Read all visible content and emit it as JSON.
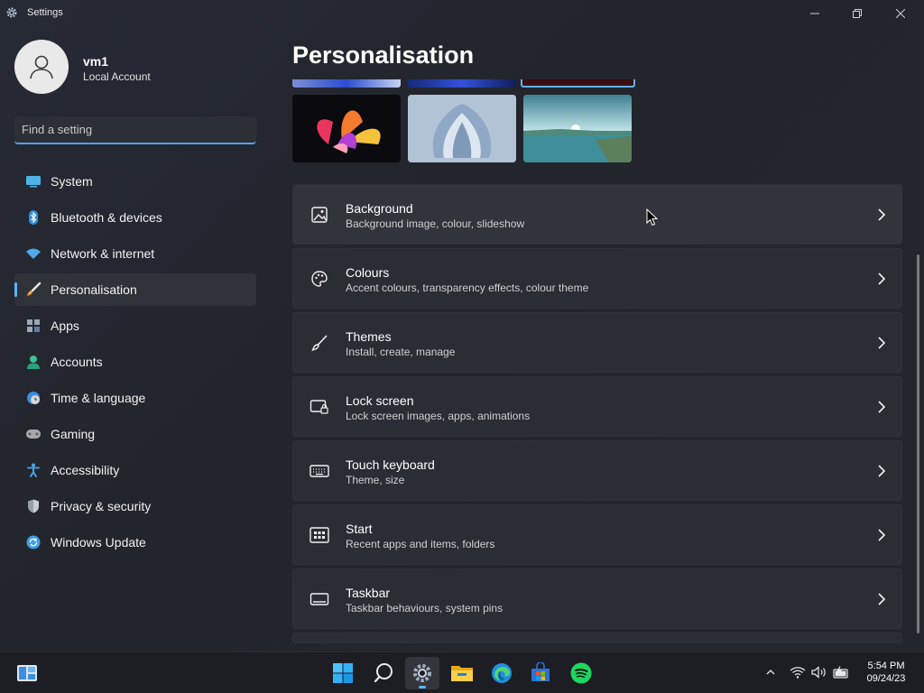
{
  "window": {
    "title": "Settings"
  },
  "user": {
    "name": "vm1",
    "account_type": "Local Account"
  },
  "search": {
    "placeholder": "Find a setting"
  },
  "sidebar": {
    "items": [
      {
        "label": "System",
        "icon": "monitor-icon"
      },
      {
        "label": "Bluetooth & devices",
        "icon": "bluetooth-icon"
      },
      {
        "label": "Network & internet",
        "icon": "wifi-icon"
      },
      {
        "label": "Personalisation",
        "icon": "brush-icon",
        "active": true
      },
      {
        "label": "Apps",
        "icon": "apps-icon"
      },
      {
        "label": "Accounts",
        "icon": "person-icon"
      },
      {
        "label": "Time & language",
        "icon": "globe-clock-icon"
      },
      {
        "label": "Gaming",
        "icon": "gamepad-icon"
      },
      {
        "label": "Accessibility",
        "icon": "accessibility-icon"
      },
      {
        "label": "Privacy & security",
        "icon": "shield-icon"
      },
      {
        "label": "Windows Update",
        "icon": "update-icon"
      }
    ]
  },
  "main": {
    "title": "Personalisation",
    "settings": [
      {
        "title": "Background",
        "subtitle": "Background image, colour, slideshow",
        "icon": "image-icon"
      },
      {
        "title": "Colours",
        "subtitle": "Accent colours, transparency effects, colour theme",
        "icon": "palette-icon"
      },
      {
        "title": "Themes",
        "subtitle": "Install, create, manage",
        "icon": "paintbrush-icon"
      },
      {
        "title": "Lock screen",
        "subtitle": "Lock screen images, apps, animations",
        "icon": "lock-screen-icon"
      },
      {
        "title": "Touch keyboard",
        "subtitle": "Theme, size",
        "icon": "keyboard-icon"
      },
      {
        "title": "Start",
        "subtitle": "Recent apps and items, folders",
        "icon": "start-icon"
      },
      {
        "title": "Taskbar",
        "subtitle": "Taskbar behaviours, system pins",
        "icon": "taskbar-icon"
      }
    ]
  },
  "taskbar": {
    "time": "5:54 PM",
    "date": "09/24/23"
  },
  "colors": {
    "accent": "#5fb2f5",
    "background": "#23252c",
    "card": "#2b2d35"
  }
}
